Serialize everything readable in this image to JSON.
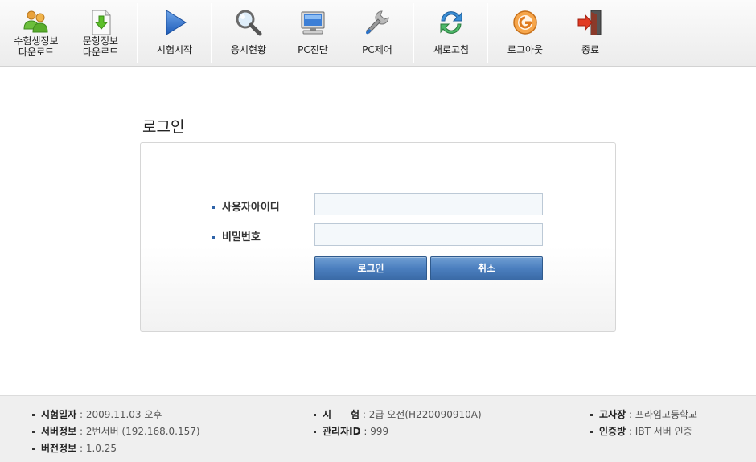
{
  "toolbar": {
    "examinee_download": "수험생정보\n다운로드",
    "question_download": "문항정보\n다운로드",
    "start_exam": "시험시작",
    "exam_status": "응시현황",
    "pc_diagnosis": "PC진단",
    "pc_control": "PC제어",
    "refresh": "새로고침",
    "logout": "로그아웃",
    "exit": "종료"
  },
  "login": {
    "title": "로그인",
    "user_id_label": "사용자아이디",
    "user_id_value": "",
    "password_label": "비밀번호",
    "password_value": "",
    "login_button": "로그인",
    "cancel_button": "취소"
  },
  "footer": {
    "exam_date_label": "시험일자",
    "exam_date_value": ": 2009.11.03 오후",
    "server_label": "서버정보",
    "server_value": ": 2번서버 (192.168.0.157)",
    "version_label": "버전정보",
    "version_value": ": 1.0.25",
    "exam_label": "시　　험",
    "exam_value": ": 2급 오전(H220090910A)",
    "admin_label": "관리자ID",
    "admin_value": ": 999",
    "site_label": "고사장",
    "site_value": ": 프라임고등학교",
    "auth_label": "인증방",
    "auth_value": ": IBT 서버 인증"
  },
  "colors": {
    "accent_blue": "#4b7fbf",
    "toolbar_bg": "#f2f2f2",
    "footer_bg": "#efefef"
  },
  "icons": [
    "users-download-icon",
    "document-download-icon",
    "play-icon",
    "magnifier-icon",
    "monitor-icon",
    "wrench-icon",
    "refresh-icon",
    "logout-icon",
    "exit-door-icon"
  ]
}
